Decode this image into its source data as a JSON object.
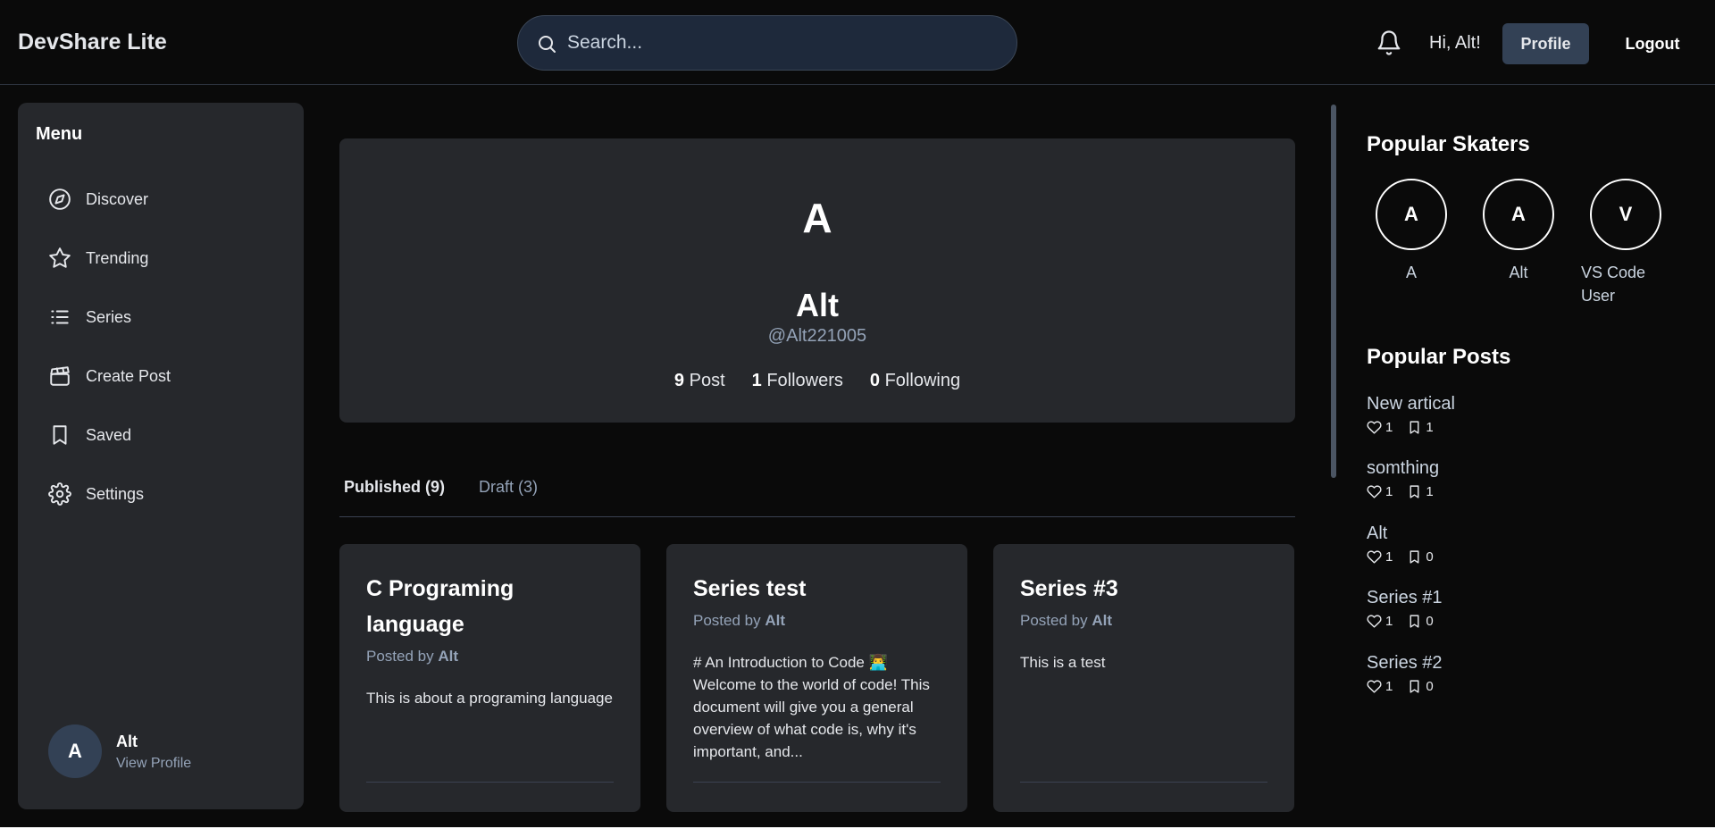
{
  "header": {
    "brand": "DevShare Lite",
    "search_placeholder": "Search...",
    "greeting": "Hi, Alt!",
    "profile_label": "Profile",
    "logout_label": "Logout"
  },
  "sidebar": {
    "title": "Menu",
    "items": [
      {
        "label": "Discover",
        "icon": "compass-icon"
      },
      {
        "label": "Trending",
        "icon": "star-icon"
      },
      {
        "label": "Series",
        "icon": "list-icon"
      },
      {
        "label": "Create Post",
        "icon": "clapperboard-icon"
      },
      {
        "label": "Saved",
        "icon": "bookmark-icon"
      },
      {
        "label": "Settings",
        "icon": "gear-icon"
      }
    ],
    "user": {
      "initial": "A",
      "name": "Alt",
      "link": "View Profile"
    }
  },
  "profile": {
    "initial": "A",
    "name": "Alt",
    "handle": "@Alt221005",
    "stats": {
      "posts_count": "9",
      "posts_label": "Post",
      "followers_count": "1",
      "followers_label": "Followers",
      "following_count": "0",
      "following_label": "Following"
    }
  },
  "tabs": {
    "published": "Published (9)",
    "draft": "Draft (3)"
  },
  "posts": [
    {
      "title": "C Programing language",
      "posted_by": "Posted by",
      "author": "Alt",
      "excerpt": "This is about a programing language"
    },
    {
      "title": "Series test",
      "posted_by": "Posted by",
      "author": "Alt",
      "excerpt": "# An Introduction to Code 👨‍💻 Welcome to the world of code! This document will give you a general overview of what code is, why it's important, and..."
    },
    {
      "title": "Series #3",
      "posted_by": "Posted by",
      "author": "Alt",
      "excerpt": "This is a test"
    }
  ],
  "right": {
    "skaters_title": "Popular Skaters",
    "skaters": [
      {
        "initial": "A",
        "name": "A"
      },
      {
        "initial": "A",
        "name": "Alt"
      },
      {
        "initial": "V",
        "name": "VS Code User"
      }
    ],
    "posts_title": "Popular Posts",
    "popular_posts": [
      {
        "title": "New artical",
        "likes": "1",
        "saves": "1"
      },
      {
        "title": "somthing",
        "likes": "1",
        "saves": "1"
      },
      {
        "title": "Alt",
        "likes": "1",
        "saves": "0"
      },
      {
        "title": "Series #1",
        "likes": "1",
        "saves": "0"
      },
      {
        "title": "Series #2",
        "likes": "1",
        "saves": "0"
      }
    ]
  },
  "colors": {
    "background": "#0a0a0a",
    "panel": "#26282c",
    "accent": "#334155",
    "muted": "#94a3b8"
  }
}
